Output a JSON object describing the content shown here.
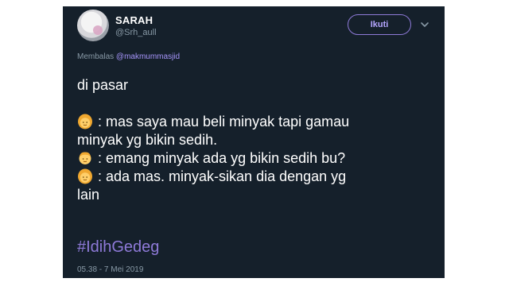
{
  "tweet": {
    "display_name": "SARAH",
    "handle": "@Srh_aull",
    "follow_label": "Ikuti",
    "reply_prefix": "Membalas",
    "reply_mention": "@makmummasjid",
    "line1": "di pasar",
    "line2": ": mas saya mau beli minyak tapi gamau",
    "line3": "minyak yg bikin sedih.",
    "line4": ": emang minyak ada yg bikin sedih bu?",
    "line5": ": ada mas. minyak-sikan dia dengan yg",
    "line6": "lain",
    "hashtag": "#IdihGedeg",
    "timestamp": "05.38 - 7 Mei 2019"
  },
  "icons": {
    "avatar": "user-avatar",
    "chevron": "chevron-down-icon",
    "emoji_woman": "woman-emoji-icon",
    "emoji_man": "man-emoji-icon"
  },
  "colors": {
    "background": "#15202b",
    "accent": "#8e7ad8",
    "muted": "#8899a6",
    "text": "#ffffff"
  }
}
